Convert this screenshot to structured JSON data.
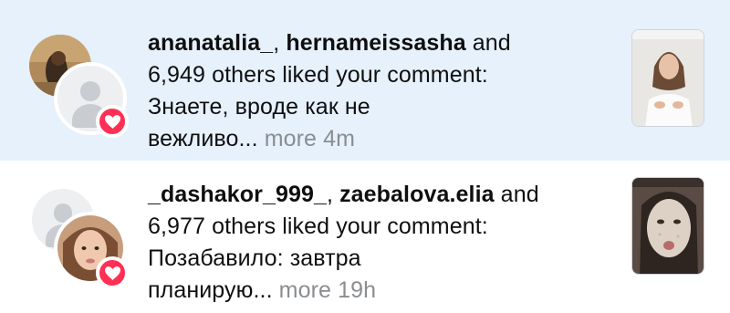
{
  "notifications": [
    {
      "users": [
        "ananatalia_",
        "hernameissasha"
      ],
      "separator": ", ",
      "and_text": " and",
      "others_line": "6,949 others liked your comment:",
      "comment_line1": "Знаете, вроде как не",
      "comment_line2": "вежливо...",
      "more_label": "more",
      "time": "4m",
      "highlighted": true,
      "heart_color": "#ff2f55",
      "highlight_bg": "#e6f1fc"
    },
    {
      "users": [
        "_dashakor_999_",
        "zaebalova.elia"
      ],
      "separator": ", ",
      "and_text": " and",
      "others_line": "6,977 others liked your comment:",
      "comment_line1": "Позабавило: завтра",
      "comment_line2": "планирую...",
      "more_label": "more",
      "time": "19h",
      "highlighted": false,
      "heart_color": "#ff2f55"
    }
  ]
}
